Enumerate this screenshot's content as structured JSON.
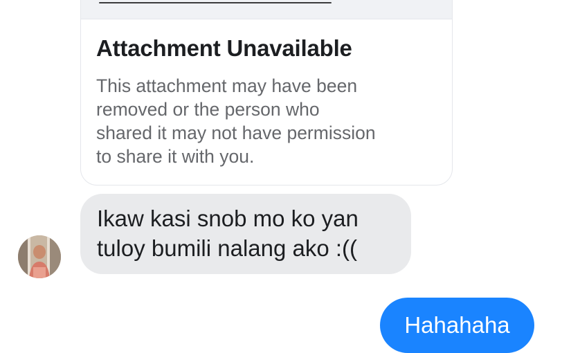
{
  "conversation": {
    "attachment": {
      "title": "Attachment Unavailable",
      "body": "This attachment may have been removed or the person who shared it may not have permission to share it with you.",
      "body_lines": [
        "This attachment may have been",
        "removed or the person who",
        "shared it may not have permission",
        "to share it with you."
      ]
    },
    "received_message": {
      "text_lines": [
        "Ikaw kasi snob mo ko yan",
        "tuloy bumili nalang ako :(("
      ]
    },
    "sent_message": {
      "text": "Hahahaha"
    }
  },
  "colors": {
    "sent_bubble": "#1a84ff",
    "received_bubble": "#e9eaec",
    "card_border": "#e4e6eb",
    "secondary_text": "#65676b"
  }
}
